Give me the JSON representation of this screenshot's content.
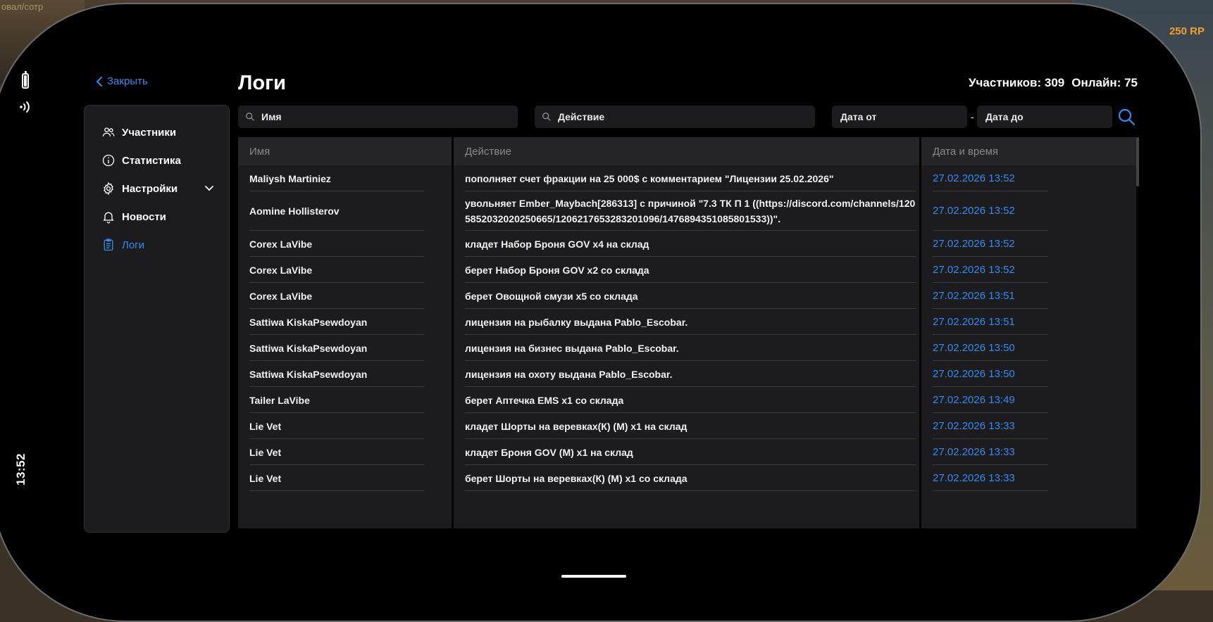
{
  "background": {
    "left_text": "овал/сотр",
    "rp_text": "250 RP"
  },
  "status": {
    "time": "13:52"
  },
  "header": {
    "close_label": "Закрыть",
    "title": "Логи",
    "members_label": "Участников: 309",
    "online_label": "Онлайн: 75"
  },
  "sidebar": {
    "items": [
      {
        "label": "Участники",
        "icon": "users-icon"
      },
      {
        "label": "Статистика",
        "icon": "info-icon"
      },
      {
        "label": "Настройки",
        "icon": "gear-icon"
      },
      {
        "label": "Новости",
        "icon": "bell-icon"
      },
      {
        "label": "Логи",
        "icon": "clipboard-icon",
        "active": true
      }
    ]
  },
  "filters": {
    "name_placeholder": "Имя",
    "action_placeholder": "Действие",
    "date_from_placeholder": "Дата от",
    "date_to_placeholder": "Дата до",
    "date_separator": "-"
  },
  "table": {
    "columns": [
      "Имя",
      "Действие",
      "Дата и время"
    ],
    "rows": [
      {
        "name": "Maliysh Martiniez",
        "action": "пополняет счет фракции на 25 000$ с комментарием \"Лицензии 25.02.2026\"",
        "datetime": "27.02.2026 13:52"
      },
      {
        "name": "Aomine Hollisterov",
        "action": "увольняет Ember_Maybach[286313] с причиной \"7.3 ТК П 1 ((https://discord.com/channels/1205852032020250665/1206217653283201096/1476894351085801533))\".",
        "datetime": "27.02.2026 13:52"
      },
      {
        "name": "Corex LaVibe",
        "action": "кладет Набор Броня GOV x4 на склад",
        "datetime": "27.02.2026 13:52"
      },
      {
        "name": "Corex LaVibe",
        "action": "берет Набор Броня GOV x2 со склада",
        "datetime": "27.02.2026 13:52"
      },
      {
        "name": "Corex LaVibe",
        "action": "берет Овощной смузи x5 со склада",
        "datetime": "27.02.2026 13:51"
      },
      {
        "name": "Sattiwa KiskaPsewdoyan",
        "action": "лицензия на рыбалку выдана Pablo_Escobar.",
        "datetime": "27.02.2026 13:51"
      },
      {
        "name": "Sattiwa KiskaPsewdoyan",
        "action": "лицензия на бизнес выдана Pablo_Escobar.",
        "datetime": "27.02.2026 13:50"
      },
      {
        "name": "Sattiwa KiskaPsewdoyan",
        "action": "лицензия на охоту выдана Pablo_Escobar.",
        "datetime": "27.02.2026 13:50"
      },
      {
        "name": "Tailer LaVibe",
        "action": "берет Аптечка EMS x1 со склада",
        "datetime": "27.02.2026 13:49"
      },
      {
        "name": "Lie Vet",
        "action": "кладет Шорты на веревках(К) (М) x1 на склад",
        "datetime": "27.02.2026 13:33"
      },
      {
        "name": "Lie Vet",
        "action": "кладет Броня GOV (М) x1 на склад",
        "datetime": "27.02.2026 13:33"
      },
      {
        "name": "Lie Vet",
        "action": "берет Шорты на веревках(К) (М) x1 со склада",
        "datetime": "27.02.2026 13:33"
      }
    ]
  },
  "colors": {
    "accent": "#2f8cf0",
    "panel": "#1c1c1e",
    "header_row": "#252527"
  }
}
